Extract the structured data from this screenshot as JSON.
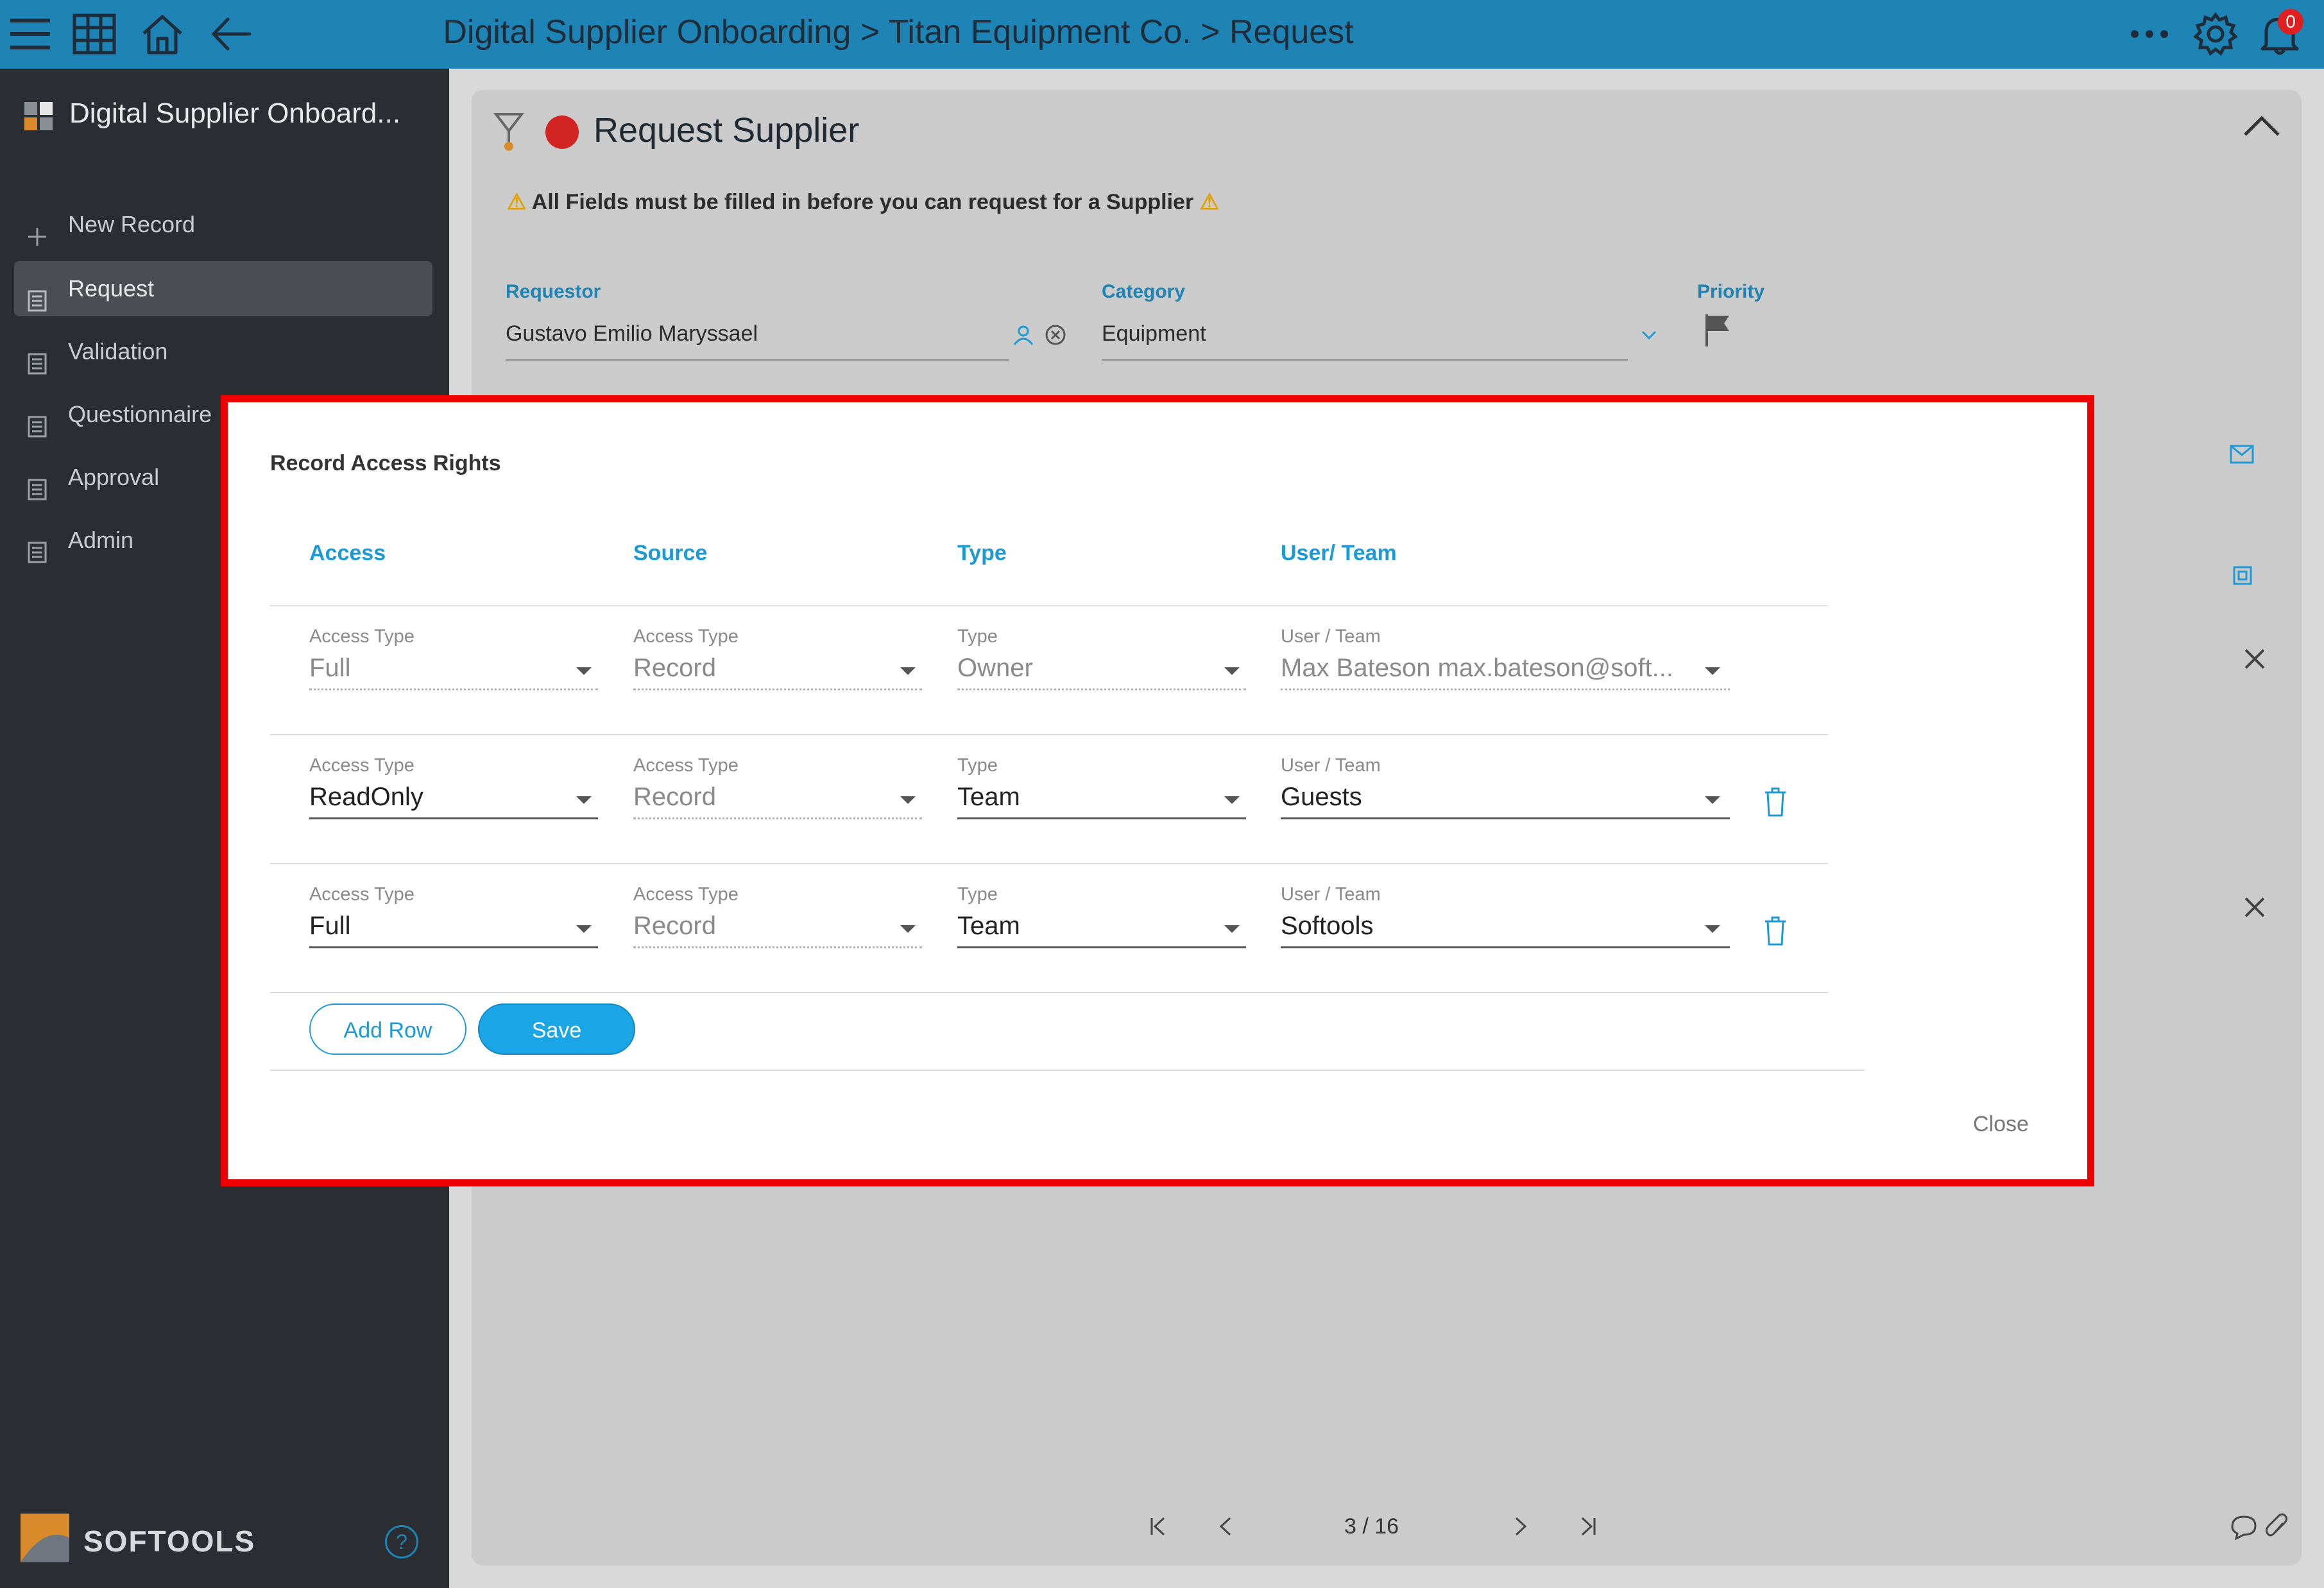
{
  "header": {
    "title": "Digital Supplier Onboarding > Titan Equipment Co. > Request",
    "notification_count": "0"
  },
  "sidebar": {
    "app_name": "Digital Supplier Onboard...",
    "items": [
      {
        "label": "New Record"
      },
      {
        "label": "Request"
      },
      {
        "label": "Validation"
      },
      {
        "label": "Questionnaire"
      },
      {
        "label": "Approval"
      },
      {
        "label": "Admin"
      }
    ],
    "brand": "SOFTOOLS",
    "help": "?"
  },
  "form": {
    "title": "Request Supplier",
    "warning": "All Fields must be filled in before you can request for a Supplier",
    "requestor_label": "Requestor",
    "requestor_value": "Gustavo Emilio Maryssael",
    "category_label": "Category",
    "category_value": "Equipment",
    "priority_label": "Priority"
  },
  "pager": {
    "text": "3 / 16"
  },
  "dialog": {
    "title": "Record Access Rights",
    "columns": [
      "Access",
      "Source",
      "Type",
      "User/ Team"
    ],
    "field_labels": {
      "access": "Access Type",
      "source": "Access Type",
      "type": "Type",
      "user": "User / Team"
    },
    "rows": [
      {
        "access": "Full",
        "source": "Record",
        "type": "Owner",
        "user": "Max Bateson max.bateson@soft..."
      },
      {
        "access": "ReadOnly",
        "source": "Record",
        "type": "Team",
        "user": "Guests"
      },
      {
        "access": "Full",
        "source": "Record",
        "type": "Team",
        "user": "Softools"
      }
    ],
    "add_row_label": "Add Row",
    "save_label": "Save",
    "close_label": "Close"
  },
  "colors": {
    "topbar": "#1d84b5",
    "sidebar": "#2a2e33",
    "accent": "#1d9ad6",
    "highlight_frame": "#ee0000",
    "status_dot": "#d32424"
  }
}
